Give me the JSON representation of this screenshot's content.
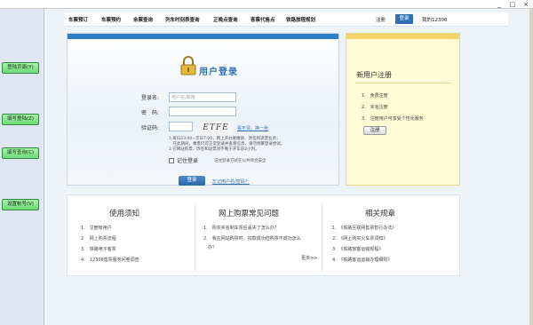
{
  "window": {
    "minimize": "_",
    "maximize": "□",
    "close": "×"
  },
  "side_buttons": [
    "登陆页面(Y)",
    "填写登陆(Z)",
    "填写查询(C)",
    "设置帐号(V)"
  ],
  "nav": {
    "items": [
      "车票预订",
      "车票预约",
      "余票查询",
      "列车时刻表查询",
      "正晚点查询",
      "客票代售点",
      "铁路旅程规划"
    ],
    "register": "注册",
    "login": "登录",
    "mine": "我的12306"
  },
  "login": {
    "title": "用户登录",
    "username_label": "登录名:",
    "username_placeholder": "用户名/邮箱",
    "password_label": "密　码:",
    "captcha_label": "验证码:",
    "captcha_text": "ETFE",
    "refresh_link": "看不清，换一张",
    "notes": [
      "1.每日23:00~次日7:00，网上开办催缴款、改签和退票业务；",
      "　在此期间，乘客仍可正常登录并查看信息，请勿频繁登录尝试。",
      "2.在网站购票、改签和退票须不晚于开车前2小时。"
    ],
    "remember_label": "记住登录",
    "remember_tip": "记住登录方式在公共场合安全",
    "login_button": "登录",
    "forgot_link": "忘记用户名/密码？"
  },
  "new_user": {
    "title": "新用户注册",
    "items": [
      "1.　免费注册",
      "2.　实名注册",
      "3.　注册用户可享受个性化服务"
    ],
    "register_button": "注册"
  },
  "info": {
    "col1": {
      "title": "使用须知",
      "items": [
        "1.　注册帐用户",
        "2.　网上购票流程",
        "3.　铁路电子客票",
        "4.　12306售票服务问卷调查"
      ]
    },
    "col2": {
      "title": "网上购票常见问题",
      "items": [
        "1.　购买实名制车票后丢失了怎么办？",
        "2.　我在网站购票时，扣款成功但购票不成功怎么",
        "　办？"
      ],
      "more": "更多>>"
    },
    "col3": {
      "title": "相关规章",
      "items": [
        "1.　《铁路互联网售票暂行办法》",
        "2.　《网上购买火车票须知》",
        "3.　《铁路旅客运输规程》",
        "4.　《铁路客运运输办理细则》"
      ]
    }
  },
  "colors": {
    "nav_login": "#2f6fb3",
    "side_button": "#6fd97a",
    "new_user_bg": "#fffbd6",
    "login_strip": "#2f7cc7"
  }
}
